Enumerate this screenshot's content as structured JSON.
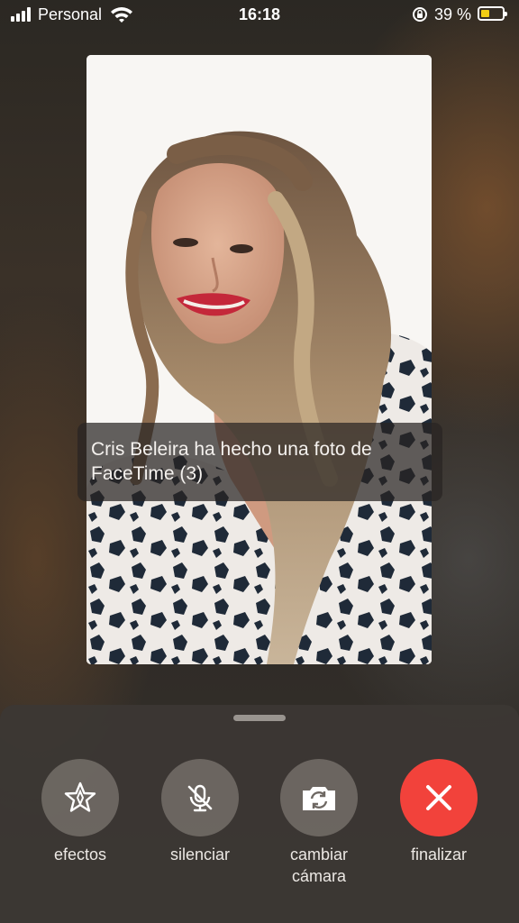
{
  "status_bar": {
    "carrier": "Personal",
    "time": "16:18",
    "battery_percent": "39 %",
    "battery_level": 0.39,
    "battery_color": "#f2cd14"
  },
  "video": {
    "description_icon": "remote-video-feed"
  },
  "banner": {
    "text": "Cris Beleira ha hecho una foto de FaceTime (3)"
  },
  "controls": {
    "effects": {
      "label": "efectos",
      "icon": "star-effects-icon"
    },
    "mute": {
      "label": "silenciar",
      "icon": "mic-off-icon"
    },
    "flip": {
      "label": "cambiar cámara",
      "icon": "camera-flip-icon"
    },
    "end": {
      "label": "finalizar",
      "icon": "close-icon",
      "color": "#f2423b"
    }
  }
}
